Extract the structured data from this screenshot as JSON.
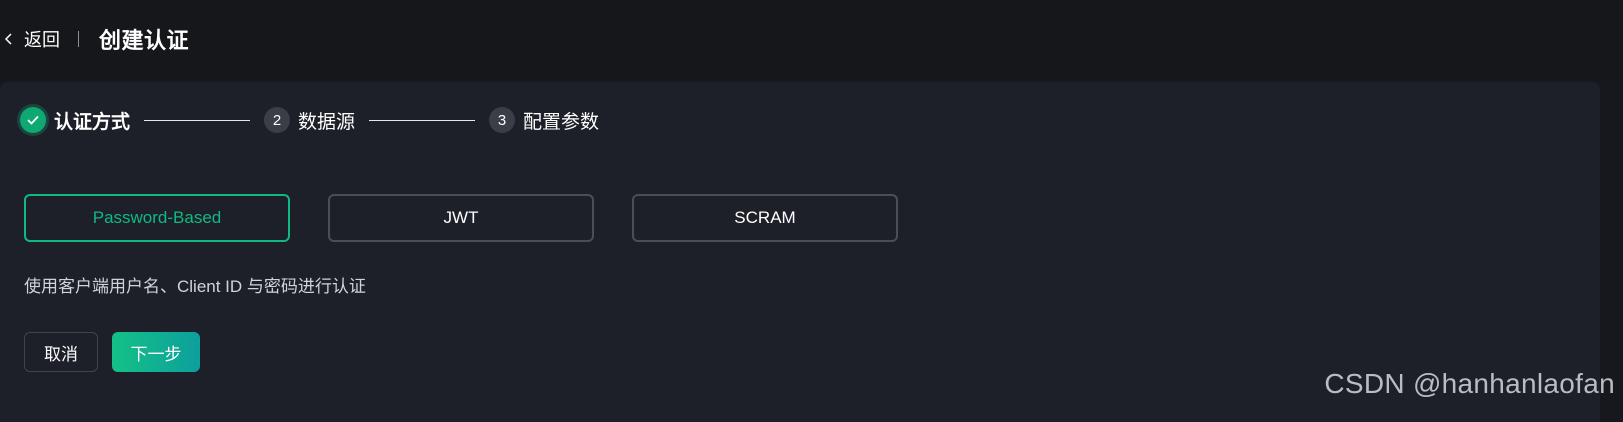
{
  "header": {
    "back_label": "返回",
    "title": "创建认证"
  },
  "steps": [
    {
      "number": "",
      "label": "认证方式",
      "status": "done"
    },
    {
      "number": "2",
      "label": "数据源",
      "status": "todo"
    },
    {
      "number": "3",
      "label": "配置参数",
      "status": "todo"
    }
  ],
  "methods": [
    {
      "label": "Password-Based",
      "selected": true
    },
    {
      "label": "JWT",
      "selected": false
    },
    {
      "label": "SCRAM",
      "selected": false
    }
  ],
  "description": "使用客户端用户名、Client ID 与密码进行认证",
  "actions": {
    "cancel_label": "取消",
    "next_label": "下一步"
  },
  "watermark": "CSDN @hanhanlaofan",
  "colors": {
    "accent": "#10b981",
    "background": "#16181d",
    "card": "#1d2029"
  },
  "icons": {
    "back": "chevron-left-icon",
    "step_done": "check-icon"
  }
}
